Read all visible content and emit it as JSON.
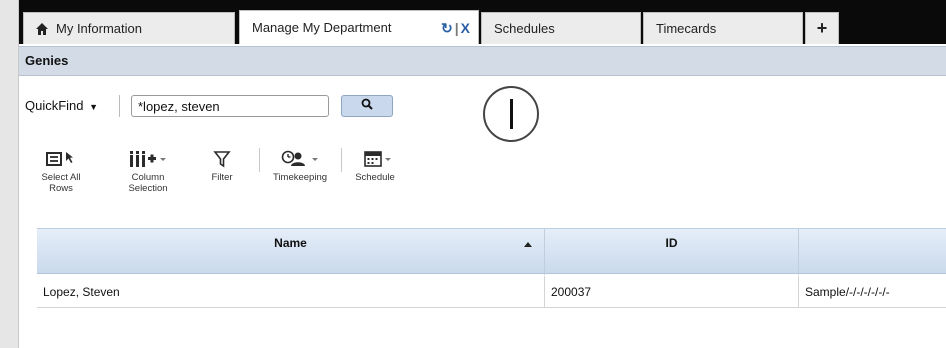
{
  "tabs": [
    {
      "label": "My Information",
      "icon": "home-icon"
    },
    {
      "label": "Manage My Department",
      "active": true
    },
    {
      "label": "Schedules"
    },
    {
      "label": "Timecards"
    },
    {
      "label": "+"
    }
  ],
  "tab_controls": {
    "refresh": "↻",
    "separator": "|",
    "close": "X"
  },
  "panel": {
    "title": "Genies"
  },
  "quickfind": {
    "label": "QuickFind",
    "caret": "▼",
    "value": "*lopez, steven"
  },
  "toolbar": [
    {
      "label_line1": "Select All",
      "label_line2": "Rows",
      "icon": "select-all-icon"
    },
    {
      "label_line1": "Column",
      "label_line2": "Selection",
      "icon": "column-selection-icon"
    },
    {
      "label_line1": "Filter",
      "label_line2": "",
      "icon": "filter-icon"
    },
    {
      "label_line1": "Timekeeping",
      "label_line2": "",
      "icon": "timekeeping-icon"
    },
    {
      "label_line1": "Schedule",
      "label_line2": "",
      "icon": "calendar-icon"
    }
  ],
  "grid": {
    "columns": [
      "Name",
      "ID",
      ""
    ],
    "rows": [
      {
        "name": "Lopez, Steven",
        "id": "200037",
        "extra": "Sample/-/-/-/-/-/-"
      }
    ]
  },
  "colors": {
    "header_bar": "#d2dbe6",
    "tab_bar": "#0a0a0a",
    "accent": "#2a5fa5"
  }
}
